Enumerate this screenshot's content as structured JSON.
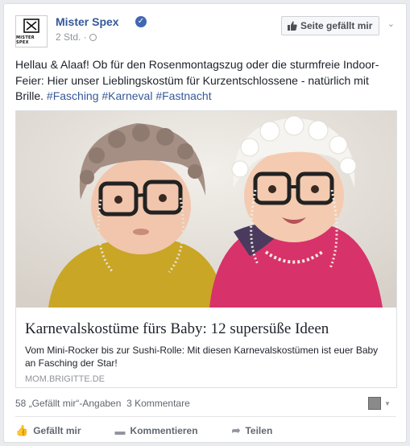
{
  "post": {
    "author": "Mister Spex",
    "logo_text": "MISTER SPEX",
    "time": "2 Std. ·",
    "like_page_label": "Seite gefällt mir",
    "text_main": "Hellau & Alaaf! Ob für den Rosenmontagszug oder die sturmfreie Indoor-Feier: Hier unser Lieblingskostüm für Kurzentschlossene - natürlich mit Brille.",
    "hashtags": [
      "#Fasching",
      "#Karneval",
      "#Fastnacht"
    ]
  },
  "link_card": {
    "title": "Karnevalskostüme fürs Baby: 12 supersüße Ideen",
    "description": "Vom Mini-Rocker bis zur Sushi-Rolle: Mit diesen Karnevalskostümen ist euer Baby an Fasching der Star!",
    "domain": "MOM.BRIGITTE.DE"
  },
  "stats": {
    "likes": "58 „Gefällt mir“-Angaben",
    "comments": "3 Kommentare"
  },
  "actions": {
    "like": "Gefällt mir",
    "comment": "Kommentieren",
    "share": "Teilen"
  },
  "icons": {
    "verified": "verified-check-icon",
    "globe": "globe-icon",
    "thumb": "thumbs-up-icon",
    "comment": "comment-bubble-icon",
    "share": "share-arrow-icon"
  },
  "colors": {
    "link_blue": "#365899",
    "verified_blue": "#4267b2",
    "muted_grey": "#90949c"
  }
}
